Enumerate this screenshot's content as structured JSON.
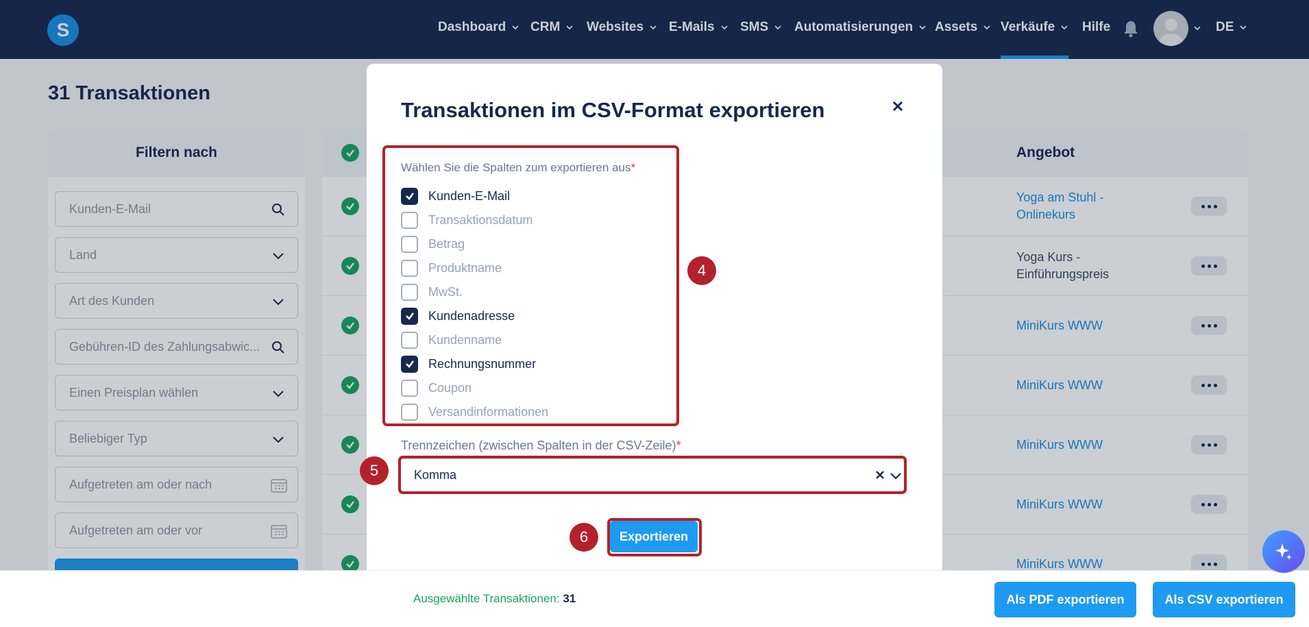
{
  "nav": {
    "logo_letter": "S",
    "items": [
      {
        "label": "Dashboard",
        "has_dropdown": true
      },
      {
        "label": "CRM",
        "has_dropdown": true
      },
      {
        "label": "Websites",
        "has_dropdown": true
      },
      {
        "label": "E-Mails",
        "has_dropdown": true
      },
      {
        "label": "SMS",
        "has_dropdown": true
      },
      {
        "label": "Automatisierungen",
        "has_dropdown": true
      },
      {
        "label": "Assets",
        "has_dropdown": true
      },
      {
        "label": "Verkäufe",
        "has_dropdown": true,
        "active": true
      },
      {
        "label": "Hilfe",
        "has_dropdown": false
      }
    ],
    "language": "DE",
    "icons": [
      "bell-icon",
      "avatar",
      "chevron-down-icon"
    ]
  },
  "page": {
    "title": "31 Transaktionen"
  },
  "filters": {
    "heading": "Filtern nach",
    "fields": [
      {
        "placeholder": "Kunden-E-Mail",
        "icon": "search-icon"
      },
      {
        "placeholder": "Land",
        "icon": "chevron-down-icon"
      },
      {
        "placeholder": "Art des Kunden",
        "icon": "chevron-down-icon"
      },
      {
        "placeholder": "Gebühren-ID des Zahlungsabwic...",
        "icon": "search-icon"
      },
      {
        "placeholder": "Einen Preisplan wählen",
        "icon": "chevron-down-icon"
      },
      {
        "placeholder": "Beliebiger Typ",
        "icon": "chevron-down-icon"
      },
      {
        "placeholder": "Aufgetreten am oder nach",
        "icon": "calendar-icon"
      },
      {
        "placeholder": "Aufgetreten am oder vor",
        "icon": "calendar-icon"
      }
    ]
  },
  "table": {
    "offer_header": "Angebot",
    "rows": [
      {
        "offer": "Yoga am Stuhl - Onlinekurs",
        "is_link": true
      },
      {
        "offer": "Yoga Kurs - Einführungspreis",
        "is_link": false
      },
      {
        "offer": "MiniKurs WWW",
        "is_link": true
      },
      {
        "offer": "MiniKurs WWW",
        "is_link": true
      },
      {
        "offer": "MiniKurs WWW",
        "is_link": true
      },
      {
        "offer": "MiniKurs WWW",
        "is_link": true
      },
      {
        "offer": "MiniKurs WWW",
        "is_link": true
      }
    ]
  },
  "bottombar": {
    "selected_label": "Ausgewählte Transaktionen:",
    "selected_count": "31",
    "pdf_button": "Als PDF exportieren",
    "csv_button": "Als CSV exportieren"
  },
  "modal": {
    "title": "Transaktionen im CSV-Format exportieren",
    "columns_label": "Wählen Sie die Spalten zum exportieren aus",
    "required_mark": "*",
    "columns": [
      {
        "label": "Kunden-E-Mail",
        "checked": true
      },
      {
        "label": "Transaktionsdatum",
        "checked": false
      },
      {
        "label": "Betrag",
        "checked": false
      },
      {
        "label": "Produktname",
        "checked": false
      },
      {
        "label": "MwSt.",
        "checked": false
      },
      {
        "label": "Kundenadresse",
        "checked": true
      },
      {
        "label": "Kundenname",
        "checked": false
      },
      {
        "label": "Rechnungsnummer",
        "checked": true
      },
      {
        "label": "Coupon",
        "checked": false
      },
      {
        "label": "Versandinformationen",
        "checked": false
      }
    ],
    "separator_label": "Trennzeichen (zwischen Spalten in der CSV-Zeile)",
    "separator_value": "Komma",
    "export_button": "Exportieren"
  },
  "annotations": {
    "steps": [
      "4",
      "5",
      "6"
    ],
    "color": "#b3222a"
  },
  "colors": {
    "nav_bg": "#17284f",
    "accent": "#1e9bf0",
    "success": "#19a463",
    "annotation": "#b3222a"
  }
}
